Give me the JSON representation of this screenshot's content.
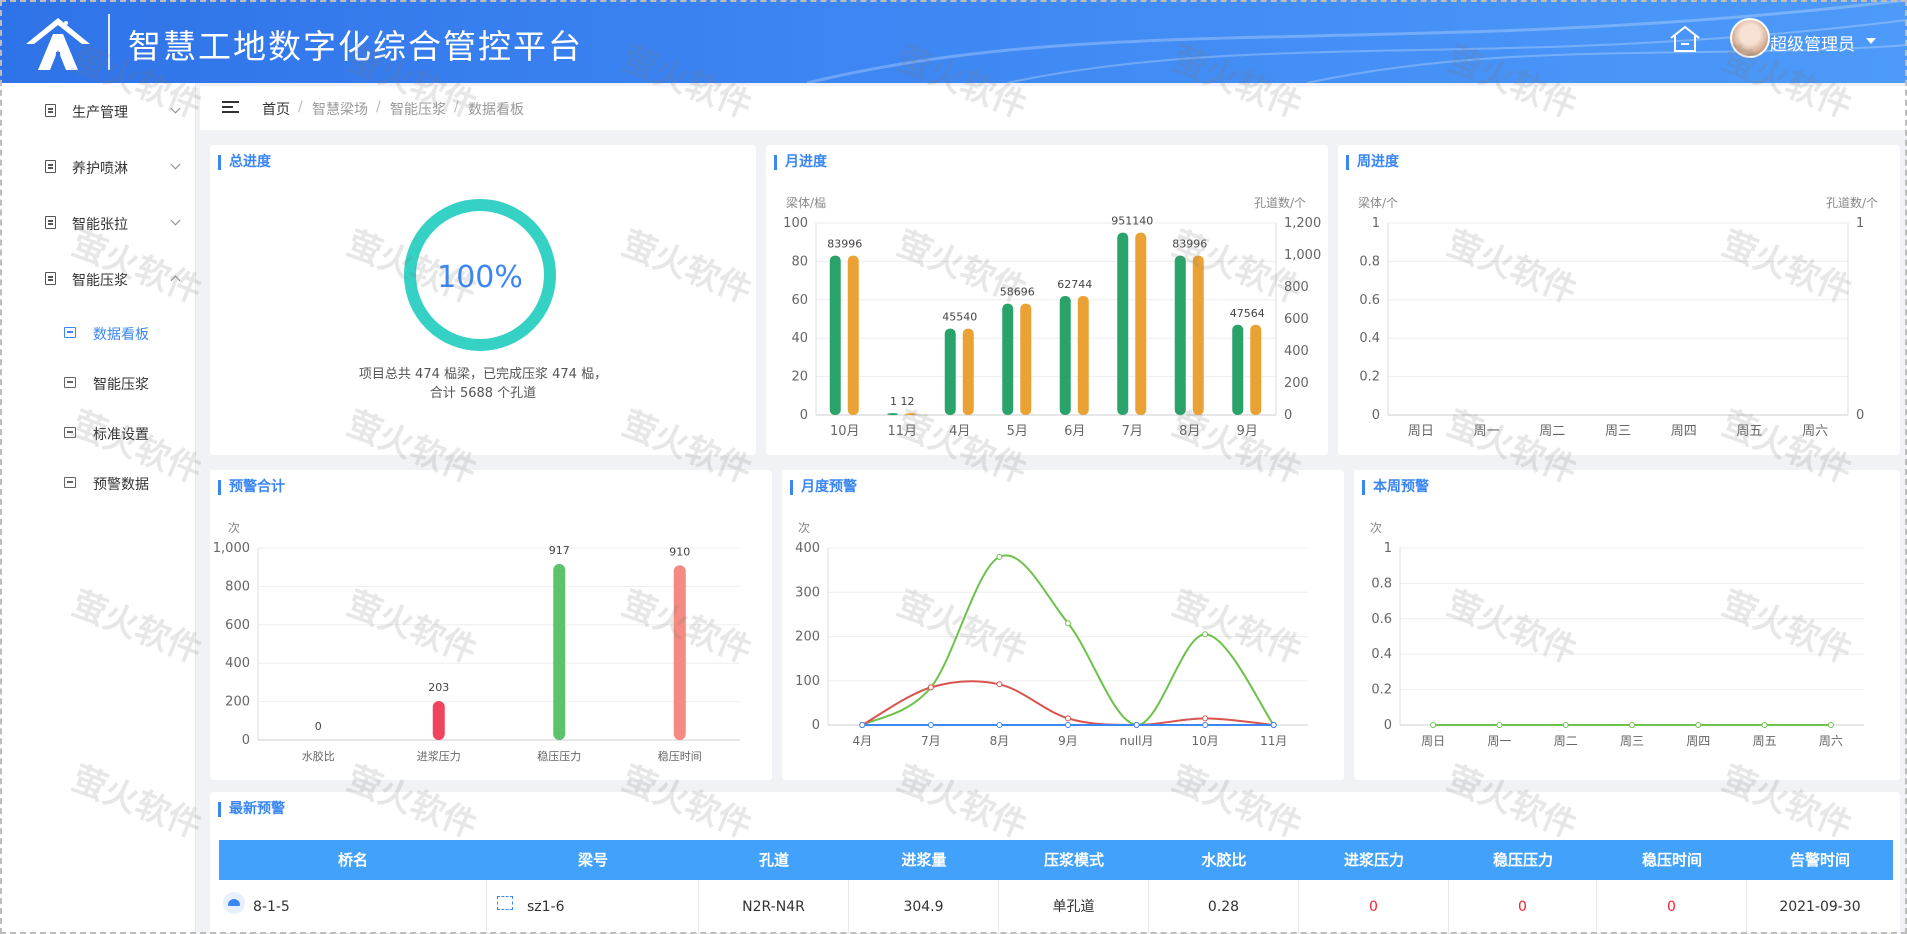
{
  "header": {
    "title": "智慧工地数字化综合管控平台",
    "user_name": "超级管理员",
    "logo_icon": "road-logo-icon",
    "home_icon": "house-icon"
  },
  "sidebar": {
    "items": [
      {
        "label": "生产管理"
      },
      {
        "label": "养护喷淋"
      },
      {
        "label": "智能张拉"
      },
      {
        "label": "智能压浆"
      }
    ],
    "sub_items": [
      {
        "label": "数据看板",
        "active": true
      },
      {
        "label": "智能压浆"
      },
      {
        "label": "标准设置"
      },
      {
        "label": "预警数据"
      }
    ]
  },
  "breadcrumb": [
    "首页",
    "智慧梁场",
    "智能压浆",
    "数据看板"
  ],
  "total_progress": {
    "title": "总进度",
    "percent_label": "100%",
    "percent": 100,
    "line1": "项目总共 474 榀梁，已完成压浆 474 榀，",
    "line2": "合计 5688 个孔道"
  },
  "monthly_progress": {
    "title": "月进度",
    "chart_data": {
      "type": "bar",
      "ylabel_left": "梁体/榀",
      "ylabel_right": "孔道数/个",
      "categories": [
        "10月",
        "11月",
        "4月",
        "5月",
        "6月",
        "7月",
        "8月",
        "9月"
      ],
      "ylim_left": [
        0,
        100
      ],
      "ylim_right": [
        0,
        1200
      ],
      "left_ticks": [
        "0",
        "20",
        "40",
        "60",
        "80",
        "100"
      ],
      "right_ticks": [
        "0",
        "200",
        "400",
        "600",
        "800",
        "1,000",
        "1,200"
      ],
      "data_labels": [
        "83996",
        "1  12",
        "45540",
        "58696",
        "62744",
        "951140",
        "83996",
        "47564"
      ],
      "series": [
        {
          "values": [
            83,
            1,
            45,
            58,
            62,
            95,
            83,
            47
          ],
          "color": "#2aa36b"
        },
        {
          "values": [
            996,
            12,
            540,
            696,
            744,
            1140,
            996,
            564
          ],
          "color": "#eba235"
        }
      ]
    }
  },
  "weekly_progress": {
    "title": "周进度",
    "chart_data": {
      "type": "bar",
      "ylabel_left": "梁体/个",
      "ylabel_right": "孔道数/个",
      "categories": [
        "周日",
        "周一",
        "周二",
        "周三",
        "周四",
        "周五",
        "周六"
      ],
      "ylim_left": [
        0,
        1
      ],
      "ylim_right": [
        0,
        1
      ],
      "left_ticks": [
        "0",
        "0.2",
        "0.4",
        "0.6",
        "0.8",
        "1"
      ],
      "right_ticks": [
        "0",
        "1"
      ],
      "series": []
    }
  },
  "alarm_total": {
    "title": "预警合计",
    "chart_data": {
      "type": "bar",
      "ylabel": "次",
      "categories": [
        "水胶比",
        "进浆压力",
        "稳压压力",
        "稳压时间"
      ],
      "values": [
        0,
        203,
        917,
        910
      ],
      "data_labels": [
        "0",
        "203",
        "917",
        "910"
      ],
      "colors": [
        "#3a86f3",
        "#f0435e",
        "#5cc26b",
        "#f58a80"
      ],
      "ylim": [
        0,
        1000
      ],
      "ticks": [
        "0",
        "200",
        "400",
        "600",
        "800",
        "1,000"
      ]
    }
  },
  "monthly_alarm": {
    "title": "月度预警",
    "chart_data": {
      "type": "line",
      "ylabel": "次",
      "categories": [
        "4月",
        "7月",
        "8月",
        "9月",
        "null月",
        "10月",
        "11月"
      ],
      "ylim": [
        0,
        400
      ],
      "ticks": [
        "0",
        "100",
        "200",
        "300",
        "400"
      ],
      "series": [
        {
          "values": [
            0,
            85,
            380,
            230,
            0,
            205,
            0
          ],
          "color": "#6cc24a"
        },
        {
          "values": [
            0,
            85,
            92,
            15,
            0,
            15,
            0
          ],
          "color": "#d9534f"
        },
        {
          "values": [
            0,
            0,
            0,
            0,
            0,
            0,
            0
          ],
          "color": "#3a86f3"
        }
      ]
    }
  },
  "weekly_alarm": {
    "title": "本周预警",
    "chart_data": {
      "type": "line",
      "ylabel": "次",
      "categories": [
        "周日",
        "周一",
        "周二",
        "周三",
        "周四",
        "周五",
        "周六"
      ],
      "ylim": [
        0,
        1
      ],
      "ticks": [
        "0",
        "0.2",
        "0.4",
        "0.6",
        "0.8",
        "1"
      ],
      "series": [
        {
          "values": [
            0,
            0,
            0,
            0,
            0,
            0,
            0
          ],
          "color": "#6cc24a"
        }
      ]
    }
  },
  "latest_alarm": {
    "title": "最新预警",
    "columns": [
      "桥名",
      "梁号",
      "孔道",
      "进浆量",
      "压浆模式",
      "水胶比",
      "进浆压力",
      "稳压压力",
      "稳压时间",
      "告警时间"
    ],
    "rows": [
      {
        "bridge": "8-1-5",
        "beam": "sz1-6",
        "duct": "N2R-N4R",
        "volume": "304.9",
        "mode": "单孔道",
        "ratio": "0.28",
        "in_pressure": "0",
        "hold_pressure": "0",
        "hold_time": "0",
        "time": "2021-09-30"
      }
    ]
  },
  "watermark": {
    "text": "萤火软件"
  }
}
